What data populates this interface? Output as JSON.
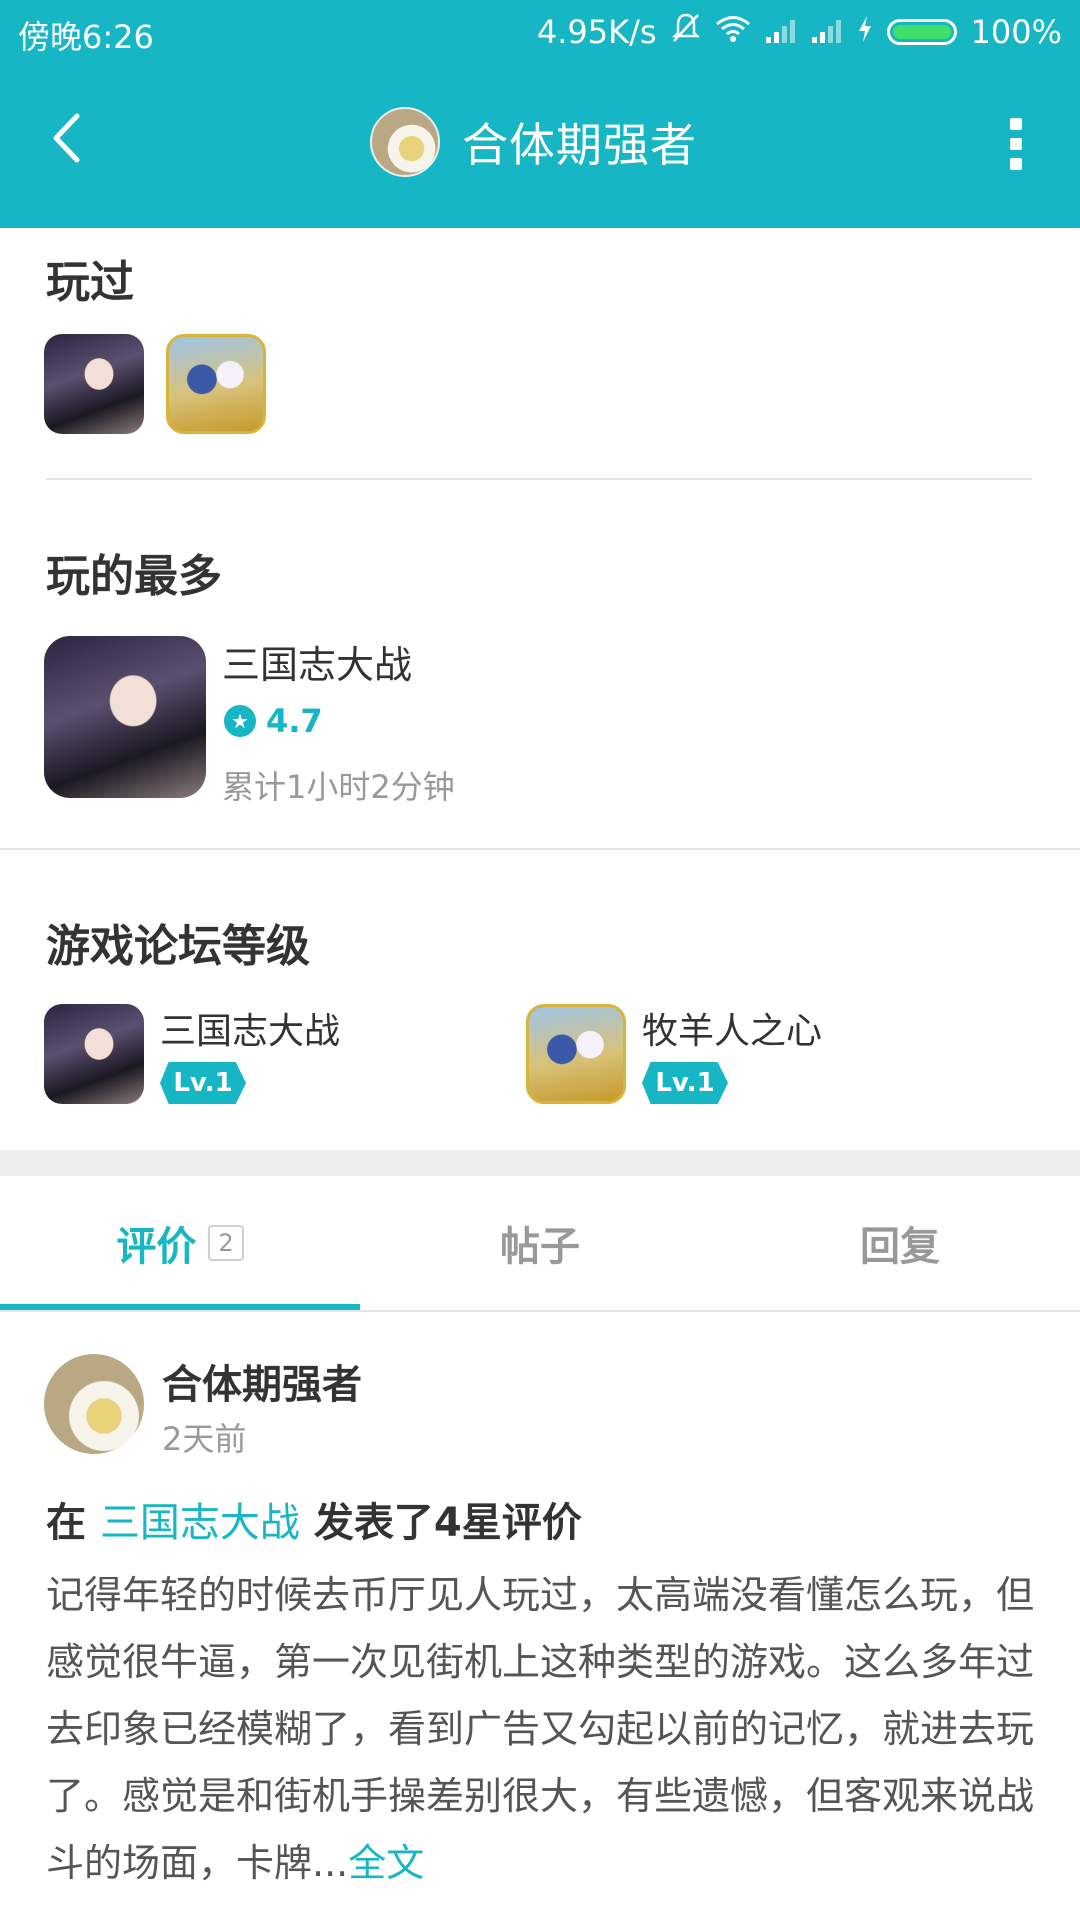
{
  "status_bar": {
    "time": "傍晚6:26",
    "network_speed": "4.95K/s",
    "battery": "100%"
  },
  "header": {
    "title": "合体期强者"
  },
  "played": {
    "title": "玩过",
    "games": [
      "三国志大战",
      "牧羊人之心"
    ]
  },
  "most_played": {
    "title": "玩的最多",
    "game_name": "三国志大战",
    "rating": "4.7",
    "playtime": "累计1小时2分钟"
  },
  "forum_level": {
    "title": "游戏论坛等级",
    "items": [
      {
        "name": "三国志大战",
        "level": "Lv.1"
      },
      {
        "name": "牧羊人之心",
        "level": "Lv.1"
      }
    ]
  },
  "tabs": [
    {
      "label": "评价",
      "count": "2"
    },
    {
      "label": "帖子"
    },
    {
      "label": "回复"
    }
  ],
  "review": {
    "user": "合体期强者",
    "time": "2天前",
    "headline_prefix": "在",
    "game_link": "三国志大战",
    "headline_suffix": "发表了4星评价",
    "body": "记得年轻的时候去币厅见人玩过，太高端没看懂怎么玩，但感觉很牛逼，第一次见街机上这种类型的游戏。这么多年过去印象已经模糊了，看到广告又勾起以前的记忆，就进去玩了。感觉是和街机手操差别很大，有些遗憾，但客观来说战斗的场面，卡牌...",
    "more_label": "全文"
  },
  "colors": {
    "accent": "#17b6c4",
    "battery_fill": "#3ee06a"
  }
}
